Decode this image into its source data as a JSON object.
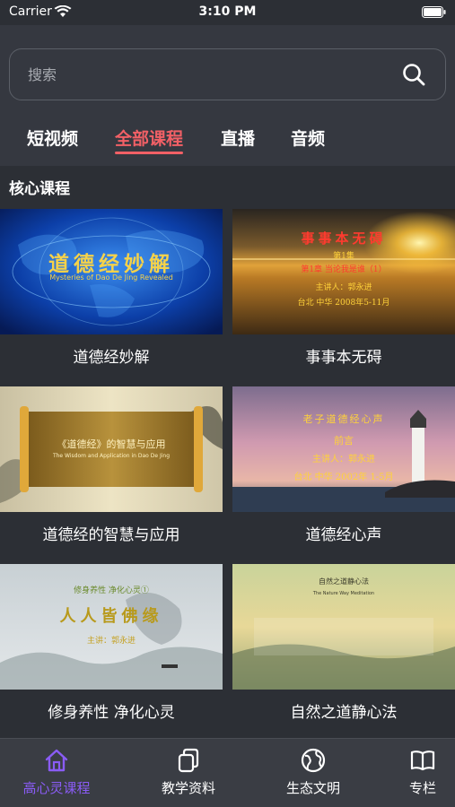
{
  "status_bar": {
    "carrier": "Carrier",
    "time": "3:10 PM"
  },
  "search": {
    "placeholder": "搜索"
  },
  "tabs": [
    {
      "label": "短视频",
      "active": false
    },
    {
      "label": "全部课程",
      "active": true
    },
    {
      "label": "直播",
      "active": false
    },
    {
      "label": "音频",
      "active": false
    }
  ],
  "section": {
    "title": "核心课程"
  },
  "courses": [
    {
      "title": "道德经妙解",
      "thumb_title": "道德经妙解",
      "thumb_subtitle": "Mysteries of Dao De Jing Revealed"
    },
    {
      "title": "事事本无碍",
      "thumb_title": "事事本无碍",
      "thumb_line1": "第1集",
      "thumb_line2": "第1章 当论我是谁（1）",
      "thumb_line3": "主讲人：郭永进",
      "thumb_line4": "台北 中华 2008年5-11月"
    },
    {
      "title": "道德经的智慧与应用",
      "thumb_title": "《道德经》的智慧与应用",
      "thumb_subtitle": "The Wisdom and Application in Dao De Jing"
    },
    {
      "title": "道德经心声",
      "thumb_title": "老子道德经心声",
      "thumb_line1": "前言",
      "thumb_line2": "主讲人：郭永进",
      "thumb_line3": "台北 中华 2002年 1-5月"
    },
    {
      "title": "修身养性 净化心灵",
      "thumb_title": "修身养性 净化心灵①",
      "thumb_line1": "人人皆佛缘",
      "thumb_line2": "主讲：郭永进"
    },
    {
      "title": "自然之道静心法",
      "thumb_title": "自然之道静心法",
      "thumb_subtitle": "The Nature Way Meditation"
    }
  ],
  "bottom_tabs": [
    {
      "label": "高心灵课程",
      "icon": "home-icon",
      "active": true
    },
    {
      "label": "教学资料",
      "icon": "documents-icon",
      "active": false
    },
    {
      "label": "生态文明",
      "icon": "globe-icon",
      "active": false
    },
    {
      "label": "专栏",
      "icon": "book-icon",
      "active": false
    }
  ],
  "colors": {
    "accent_tab": "#f26066",
    "accent_bottom": "#8a5cf5",
    "background": "#2c2f35",
    "header": "#353840"
  }
}
